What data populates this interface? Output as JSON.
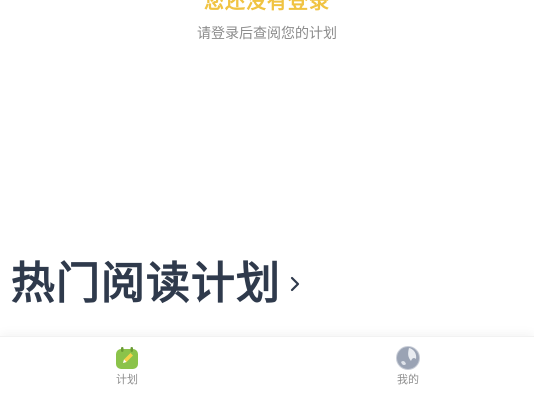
{
  "login_prompt": {
    "title": "您还没有登录",
    "subtitle": "请登录后查阅您的计划"
  },
  "popular_plans": {
    "title": "热门阅读计划"
  },
  "tabbar": {
    "items": [
      {
        "label": "计划",
        "icon": "calendar-pencil-icon",
        "active": true
      },
      {
        "label": "我的",
        "icon": "avatar-icon",
        "active": false
      }
    ]
  },
  "colors": {
    "accent_yellow": "#f0c342",
    "title_dark": "#2f3a4c",
    "plan_icon_green": "#8bc34a"
  }
}
